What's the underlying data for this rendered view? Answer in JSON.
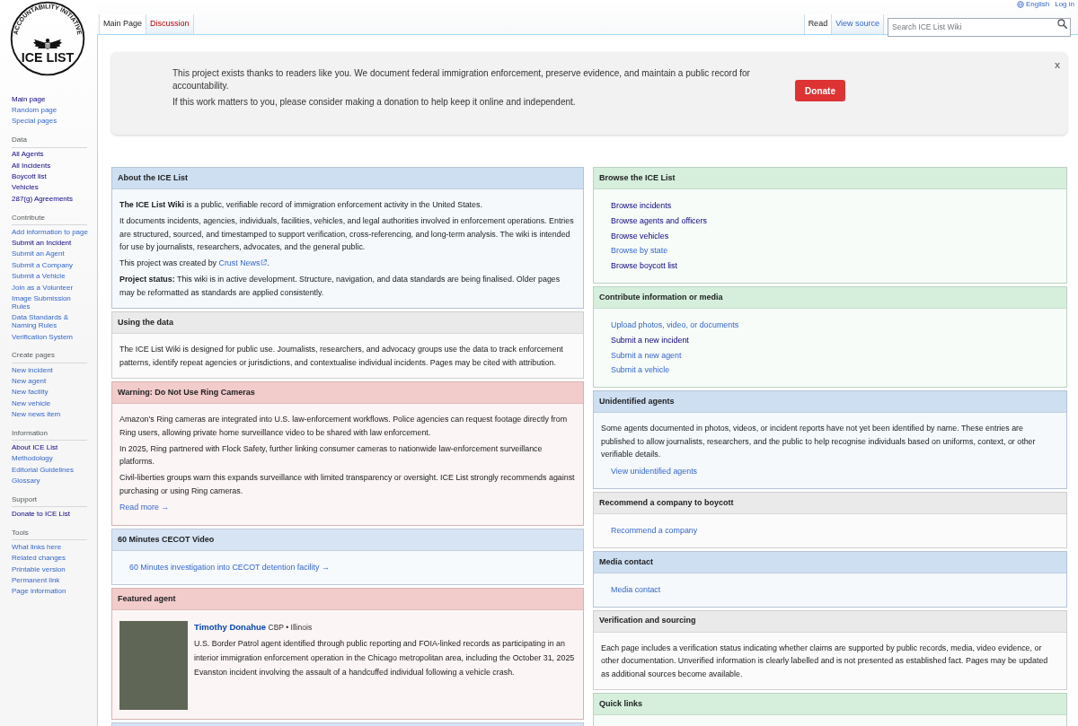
{
  "personal_tools": [
    {
      "kind": "language",
      "label": "English"
    },
    {
      "kind": "link",
      "label": "Log in"
    }
  ],
  "logo": {
    "arc_text": "ACCOUNTABILITY INITIATIVE",
    "wordmark": "ICE LIST"
  },
  "sidebar": [
    {
      "items": [
        {
          "label": "Main page",
          "visited": true
        },
        {
          "label": "Random page",
          "visited": false
        },
        {
          "label": "Special pages",
          "visited": false
        }
      ]
    },
    {
      "heading": "Data",
      "items": [
        {
          "label": "All Agents",
          "visited": true
        },
        {
          "label": "All Incidents",
          "visited": true
        },
        {
          "label": "Boycott list",
          "visited": true
        },
        {
          "label": "Vehicles",
          "visited": true
        },
        {
          "label": "287(g) Agreements",
          "visited": true
        }
      ]
    },
    {
      "heading": "Contribute",
      "items": [
        {
          "label": "Add information to page",
          "visited": false
        },
        {
          "label": "Submit an Incident",
          "visited": true
        },
        {
          "label": "Submit an Agent",
          "visited": false
        },
        {
          "label": "Submit a Company",
          "visited": false
        },
        {
          "label": "Submit a Vehicle",
          "visited": false
        },
        {
          "label": "Join as a Volunteer",
          "visited": false
        },
        {
          "label": "Image Submission Rules",
          "visited": false
        },
        {
          "label": "Data Standards & Naming Rules",
          "visited": false
        },
        {
          "label": "Verification System",
          "visited": false
        }
      ]
    },
    {
      "heading": "Create pages",
      "items": [
        {
          "label": "New incident",
          "visited": false
        },
        {
          "label": "New agent",
          "visited": false
        },
        {
          "label": "New facility",
          "visited": false
        },
        {
          "label": "New vehicle",
          "visited": false
        },
        {
          "label": "New news item",
          "visited": false
        }
      ]
    },
    {
      "heading": "Information",
      "items": [
        {
          "label": "About ICE List",
          "visited": true
        },
        {
          "label": "Methodology",
          "visited": false
        },
        {
          "label": "Editorial Guidelines",
          "visited": false
        },
        {
          "label": "Glossary",
          "visited": false
        }
      ]
    },
    {
      "heading": "Support",
      "items": [
        {
          "label": "Donate to ICE List",
          "visited": true
        }
      ]
    },
    {
      "heading": "Tools",
      "items": [
        {
          "label": "What links here",
          "visited": false
        },
        {
          "label": "Related changes",
          "visited": false
        },
        {
          "label": "Printable version",
          "visited": false
        },
        {
          "label": "Permanent link",
          "visited": false
        },
        {
          "label": "Page information",
          "visited": false
        }
      ]
    }
  ],
  "tabs_left": [
    {
      "label": "Main Page",
      "selected": true,
      "redlink": false
    },
    {
      "label": "Discussion",
      "selected": false,
      "redlink": true
    }
  ],
  "tabs_right": [
    {
      "label": "Read",
      "selected": true
    },
    {
      "label": "View source",
      "selected": false
    }
  ],
  "search": {
    "placeholder": "Search ICE List Wiki"
  },
  "banner": {
    "paragraphs": [
      "This project exists thanks to readers like you. We document federal immigration enforcement, preserve evidence, and maintain a public record for accountability.",
      "If this work matters to you, please consider making a donation to help keep it online and independent."
    ],
    "button": "Donate",
    "close": "x"
  },
  "columns": [
    {
      "panels": [
        {
          "title": "About the ICE List",
          "color": "#cedff2",
          "body": [
            {
              "kind": "paragraph",
              "text": "**The ICE List Wiki** is a public, verifiable record of immigration enforcement activity in the United States."
            },
            {
              "kind": "paragraph",
              "text": "It documents incidents, agencies, individuals, facilities, vehicles, and legal authorities involved in enforcement operations. Entries are structured, sourced, and timestamped to support verification, cross-referencing, and long-term analysis. The wiki is intended for use by journalists, researchers, advocates, and the general public."
            },
            {
              "kind": "credit",
              "before": "This project was created by ",
              "link": {
                "label": "Crust News",
                "visited": false,
                "external": true
              },
              "after": "."
            },
            {
              "kind": "paragraph",
              "text": "**Project status:** This wiki is in active development. Structure, navigation, and data standards are being finalised. Older pages may be reformatted as standards are applied consistently."
            }
          ]
        },
        {
          "title": "Using the data",
          "color": "#eaeaea",
          "body": [
            {
              "kind": "paragraph",
              "text": "The ICE List Wiki is designed for public use. Journalists, researchers, and advocacy groups use the data to track enforcement patterns, identify repeat agencies or jurisdictions, and contextualise individual incidents. Pages may be cited with attribution."
            }
          ]
        },
        {
          "title": "Warning: Do Not Use Ring Cameras",
          "color": "#f2cbcb",
          "body": [
            {
              "kind": "paragraph",
              "text": "Amazon’s Ring cameras are integrated into U.S. law-enforcement workflows. Police agencies can request footage directly from Ring users, allowing private home surveillance video to be shared with law enforcement."
            },
            {
              "kind": "paragraph",
              "text": "In 2025, Ring partnered with Flock Safety, further linking consumer cameras to nationwide law-enforcement surveillance platforms."
            },
            {
              "kind": "paragraph",
              "text": "Civil-liberties groups warn this expands surveillance with limited transparency or oversight. ICE List strongly recommends against purchasing or using Ring cameras."
            },
            {
              "kind": "link",
              "label": "Read more →",
              "visited": false
            }
          ]
        },
        {
          "title": "60 Minutes CECOT Video",
          "color": "#d6e4f4",
          "body": [
            {
              "kind": "links",
              "items": [
                {
                  "label": "60 Minutes investigation into CECOT detention facility →",
                  "visited": false
                }
              ]
            }
          ]
        },
        {
          "title": "Featured agent",
          "color": "#f2cbcb",
          "body": [
            {
              "kind": "agent",
              "name": "Timothy Donahue",
              "meta": "CBP • Illinois",
              "text": "U.S. Border Patrol agent identified through public reporting and FOIA-linked records as participating in an interior immigration enforcement operation in the Chicago metropolitan area, including the October 31, 2025 Evanston incident involving the assault of a handcuffed individual following a vehicle crash."
            }
          ]
        },
        {
          "color": "#d6e4f4"
        }
      ]
    },
    {
      "panels": [
        {
          "title": "Browse the ICE List",
          "color": "#d5efdc",
          "body": [
            {
              "kind": "links",
              "items": [
                {
                  "label": "Browse incidents",
                  "visited": true
                },
                {
                  "label": "Browse agents and officers",
                  "visited": true
                },
                {
                  "label": "Browse vehicles",
                  "visited": true
                },
                {
                  "label": "Browse by state",
                  "visited": false
                },
                {
                  "label": "Browse boycott list",
                  "visited": true
                }
              ]
            }
          ]
        },
        {
          "title": "Contribute information or media",
          "color": "#d5efdc",
          "body": [
            {
              "kind": "links",
              "items": [
                {
                  "label": "Upload photos, video, or documents",
                  "visited": false
                },
                {
                  "label": "Submit a new incident",
                  "visited": true
                },
                {
                  "label": "Submit a new agent",
                  "visited": false
                },
                {
                  "label": "Submit a vehicle",
                  "visited": false
                }
              ]
            }
          ]
        },
        {
          "title": "Unidentified agents",
          "color": "#cedff2",
          "body": [
            {
              "kind": "paragraph",
              "text": "Some agents documented in photos, videos, or incident reports have not yet been identified by name. These entries are published to allow journalists, researchers, and the public to help recognise individuals based on uniforms, context, or other verifiable details."
            },
            {
              "kind": "links",
              "items": [
                {
                  "label": "View unidentified agents",
                  "visited": false
                }
              ]
            }
          ]
        },
        {
          "title": "Recommend a company to boycott",
          "color": "#eaeaea",
          "body": [
            {
              "kind": "links",
              "items": [
                {
                  "label": "Recommend a company",
                  "visited": false
                }
              ]
            }
          ]
        },
        {
          "title": "Media contact",
          "color": "#cedff2",
          "body": [
            {
              "kind": "links",
              "items": [
                {
                  "label": "Media contact",
                  "visited": false
                }
              ]
            }
          ]
        },
        {
          "title": "Verification and sourcing",
          "color": "#eaeaea",
          "body": [
            {
              "kind": "paragraph",
              "text": "Each page includes a verification status indicating whether claims are supported by public records, media, video evidence, or other documentation. Unverified information is clearly labelled and is not presented as established fact. Pages may be updated as additional sources become available."
            }
          ]
        },
        {
          "title": "Quick links",
          "color": "#d5efdc"
        }
      ]
    }
  ]
}
